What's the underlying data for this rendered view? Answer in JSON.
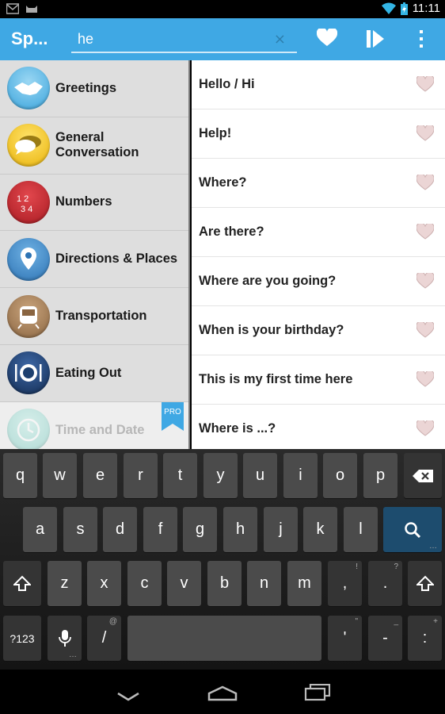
{
  "status_bar": {
    "time": "11:11"
  },
  "app_bar": {
    "title": "Sp...",
    "search_value": "he",
    "clear_glyph": "×"
  },
  "categories": [
    {
      "label": "Greetings",
      "icon": "handshake-icon",
      "color": "#5fb7e3"
    },
    {
      "label": "General Conversation",
      "icon": "speech-bubbles-icon",
      "color": "#f2c81d"
    },
    {
      "label": "Numbers",
      "icon": "numbers-icon",
      "color": "#c6262c"
    },
    {
      "label": "Directions & Places",
      "icon": "map-pin-icon",
      "color": "#3e88c5"
    },
    {
      "label": "Transportation",
      "icon": "train-icon",
      "color": "#9b7650"
    },
    {
      "label": "Eating Out",
      "icon": "plate-cutlery-icon",
      "color": "#1d3f6e"
    },
    {
      "label": "Time and Date",
      "icon": "clock-icon",
      "color": "#7fd1c6",
      "badge": "PRO"
    }
  ],
  "phrases": [
    "Hello / Hi",
    "Help!",
    "Where?",
    "Are there?",
    "Where are you going?",
    "When is your birthday?",
    "This is my first time here",
    "Where is ...?"
  ],
  "keyboard": {
    "row1": [
      "q",
      "w",
      "e",
      "r",
      "t",
      "y",
      "u",
      "i",
      "o",
      "p"
    ],
    "row2": [
      "a",
      "s",
      "d",
      "f",
      "g",
      "h",
      "j",
      "k",
      "l"
    ],
    "row3": [
      "z",
      "x",
      "c",
      "v",
      "b",
      "n",
      "m",
      ",",
      "."
    ],
    "row3_hints": [
      "!",
      "?"
    ],
    "symbols_label": "?123",
    "slash": "/",
    "slash_hint": "@",
    "apostrophe": "'",
    "apostrophe_hint": "\"",
    "dash": "-",
    "dash_hint": "_",
    "colon": ":",
    "colon_hint": "+"
  },
  "colors": {
    "accent": "#3fa8e4",
    "heart": "#e7cfcf"
  }
}
